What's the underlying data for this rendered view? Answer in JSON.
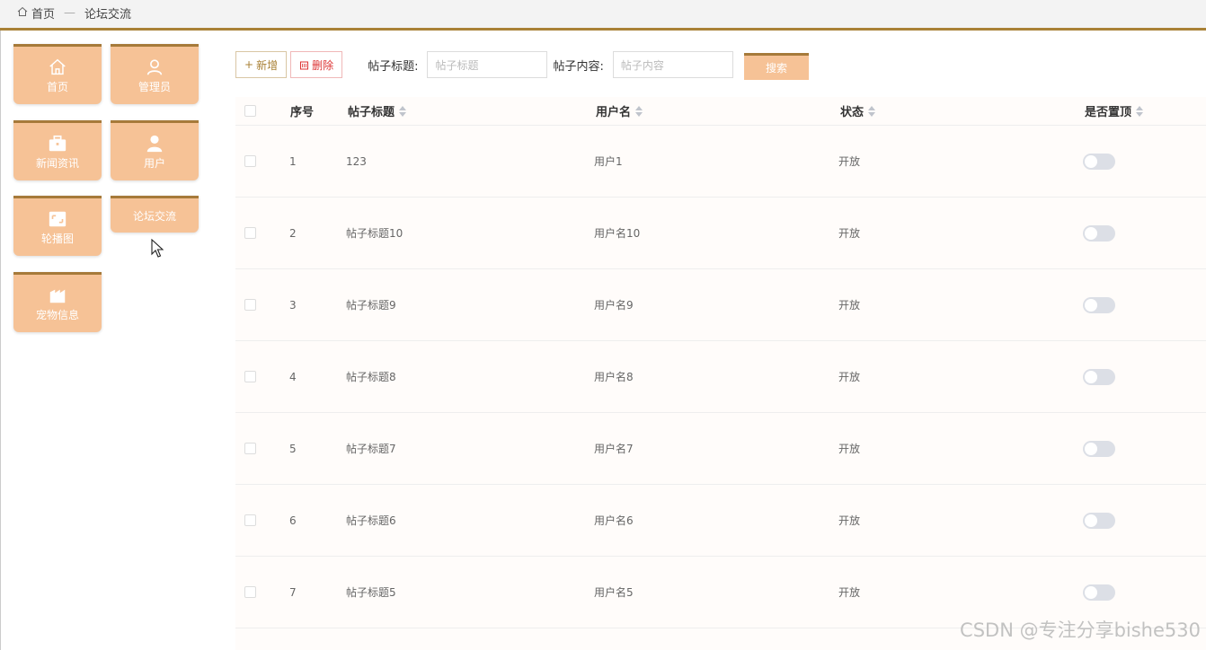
{
  "breadcrumb": {
    "home": "首页",
    "separator": "—",
    "current": "论坛交流"
  },
  "sidebar": {
    "tiles": [
      {
        "label": "首页",
        "icon": "home-icon"
      },
      {
        "label": "管理员",
        "icon": "person-icon"
      },
      {
        "label": "新闻资讯",
        "icon": "briefcase-icon"
      },
      {
        "label": "用户",
        "icon": "user-icon"
      },
      {
        "label": "轮播图",
        "icon": "image-icon"
      },
      {
        "label": "论坛交流",
        "icon": ""
      },
      {
        "label": "宠物信息",
        "icon": "building-icon"
      }
    ]
  },
  "toolbar": {
    "add_label": "新增",
    "delete_label": "删除",
    "title_label": "帖子标题:",
    "title_placeholder": "帖子标题",
    "content_label": "帖子内容:",
    "content_placeholder": "帖子内容",
    "search_label": "搜索"
  },
  "table": {
    "headers": {
      "index": "序号",
      "title": "帖子标题",
      "username": "用户名",
      "status": "状态",
      "pinned": "是否置顶"
    },
    "rows": [
      {
        "index": "1",
        "title": "123",
        "username": "用户1",
        "status": "开放"
      },
      {
        "index": "2",
        "title": "帖子标题10",
        "username": "用户名10",
        "status": "开放"
      },
      {
        "index": "3",
        "title": "帖子标题9",
        "username": "用户名9",
        "status": "开放"
      },
      {
        "index": "4",
        "title": "帖子标题8",
        "username": "用户名8",
        "status": "开放"
      },
      {
        "index": "5",
        "title": "帖子标题7",
        "username": "用户名7",
        "status": "开放"
      },
      {
        "index": "6",
        "title": "帖子标题6",
        "username": "用户名6",
        "status": "开放"
      },
      {
        "index": "7",
        "title": "帖子标题5",
        "username": "用户名5",
        "status": "开放"
      }
    ]
  },
  "watermark": "CSDN @专注分享bishe530",
  "colors": {
    "accent": "#a98136",
    "tile": "#f6c296",
    "danger": "#dd3333"
  }
}
